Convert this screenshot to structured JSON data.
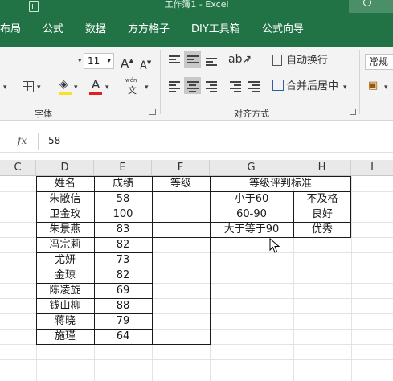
{
  "title_bar": {
    "title": "工作簿1 - Excel"
  },
  "tabs": [
    "布局",
    "公式",
    "数据",
    "方方格子",
    "DIY工具箱",
    "公式向导"
  ],
  "ribbon": {
    "font_size": "11",
    "grow_font": "A",
    "shrink_font": "A",
    "wen_label": "wén",
    "wen_char": "文",
    "font_color_letter": "A",
    "wrap_text": "自动换行",
    "merge_center": "合并后居中",
    "number_format": "常规",
    "group_font": "字体",
    "group_alignment": "对齐方式"
  },
  "formula_bar": {
    "fx": "fx",
    "value": "58"
  },
  "columns": [
    "C",
    "D",
    "E",
    "F",
    "G",
    "H",
    "I"
  ],
  "table_main": {
    "headers": [
      "姓名",
      "成绩",
      "等级"
    ],
    "rows": [
      {
        "name": "朱敞信",
        "score": "58"
      },
      {
        "name": "卫金玫",
        "score": "100"
      },
      {
        "name": "朱景燕",
        "score": "83"
      },
      {
        "name": "冯宗莉",
        "score": "82"
      },
      {
        "name": "尤妍",
        "score": "73"
      },
      {
        "name": "金琼",
        "score": "82"
      },
      {
        "name": "陈凌旋",
        "score": "69"
      },
      {
        "name": "钱山柳",
        "score": "88"
      },
      {
        "name": "蒋晓",
        "score": "79"
      },
      {
        "name": "施瑾",
        "score": "64"
      }
    ]
  },
  "table_standard": {
    "title": "等级评判标准",
    "rows": [
      {
        "range": "小于60",
        "grade": "不及格"
      },
      {
        "range": "60-90",
        "grade": "良好"
      },
      {
        "range": "大于等于90",
        "grade": "优秀"
      }
    ]
  },
  "colors": {
    "excel_green": "#217346",
    "fill_yellow": "#f7e225",
    "font_red": "#e02020"
  }
}
